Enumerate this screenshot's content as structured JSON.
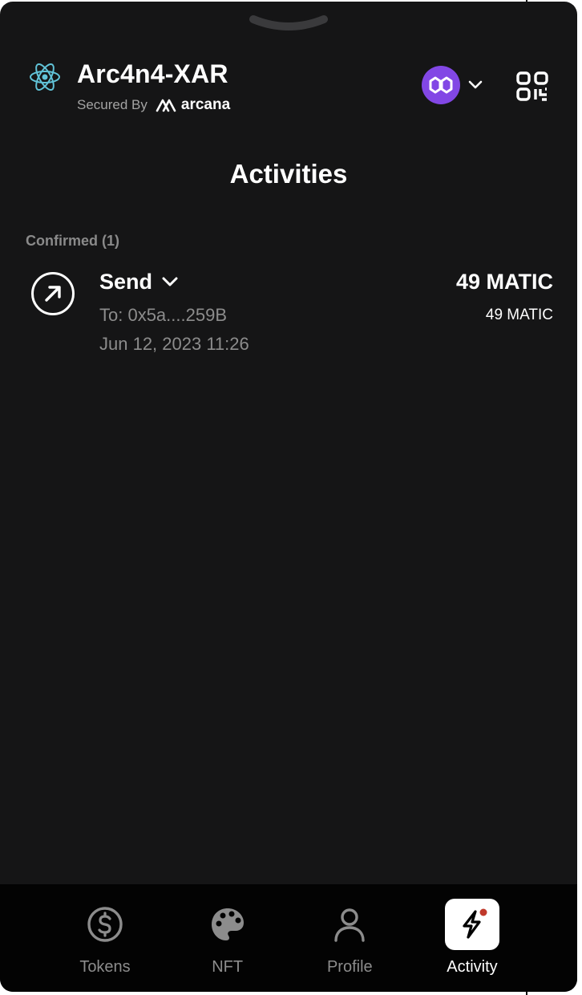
{
  "app": {
    "name": "Arc4n4-XAR",
    "secured_by": "Secured By",
    "brand": "arcana"
  },
  "network": {
    "icon": "polygon-icon",
    "color": "#8247e5"
  },
  "page": {
    "title": "Activities"
  },
  "sections": [
    {
      "label": "Confirmed (1)",
      "items": [
        {
          "type": "Send",
          "to": "To: 0x5a....259B",
          "date": "Jun 12, 2023 11:26",
          "amount": "49 MATIC",
          "amount_secondary": "49 MATIC"
        }
      ]
    }
  ],
  "nav": {
    "active": "Activity",
    "items": [
      {
        "label": "Tokens",
        "icon": "dollar-circle-icon"
      },
      {
        "label": "NFT",
        "icon": "palette-icon"
      },
      {
        "label": "Profile",
        "icon": "user-icon"
      },
      {
        "label": "Activity",
        "icon": "lightning-icon",
        "has_notification": true
      }
    ]
  },
  "colors": {
    "background": "#151516",
    "nav_background": "#030303",
    "notification": "#c0392b"
  }
}
